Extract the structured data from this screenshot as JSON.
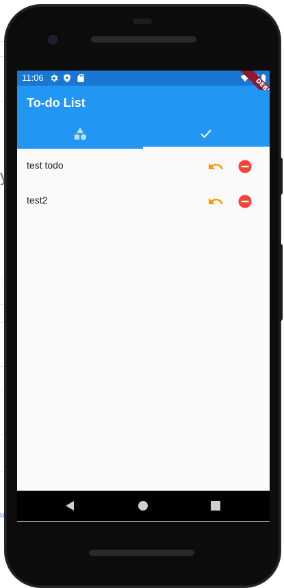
{
  "status_bar": {
    "time": "11:06",
    "icons": [
      "settings-icon",
      "shield-icon",
      "sd-card-icon",
      "wifi-icon",
      "signal-icon",
      "battery-icon"
    ]
  },
  "debug_banner": "DEBUG",
  "app_bar": {
    "title": "To-do List",
    "color": "#2196f3",
    "status_color": "#1976d2"
  },
  "tabs": [
    {
      "icon": "category-shapes-icon",
      "selected": false
    },
    {
      "icon": "check-icon",
      "selected": true
    }
  ],
  "todos": [
    {
      "label": "test todo",
      "actions": [
        "undo-icon",
        "remove-circle-icon"
      ]
    },
    {
      "label": "test2",
      "actions": [
        "undo-icon",
        "remove-circle-icon"
      ]
    }
  ],
  "action_colors": {
    "undo": "#ff9800",
    "remove": "#f44336"
  },
  "nav_bar": {
    "buttons": [
      "back-icon",
      "home-icon",
      "overview-icon"
    ]
  }
}
